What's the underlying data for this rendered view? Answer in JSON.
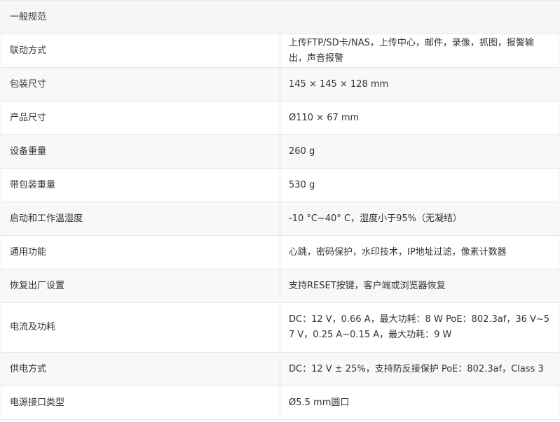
{
  "section": {
    "title": "一般规范"
  },
  "rows": [
    {
      "label": "联动方式",
      "value": "上传FTP/SD卡/NAS，上传中心，邮件，录像，抓图，报警输出，声音报警"
    },
    {
      "label": "包装尺寸",
      "value": "145 × 145 × 128 mm"
    },
    {
      "label": "产品尺寸",
      "value": "Ø110 × 67 mm"
    },
    {
      "label": "设备重量",
      "value": "260 g"
    },
    {
      "label": "带包装重量",
      "value": "530 g"
    },
    {
      "label": "启动和工作温湿度",
      "value": "-10 °C~40° C，湿度小于95%（无凝结）"
    },
    {
      "label": "通用功能",
      "value": "心跳，密码保护，水印技术，IP地址过滤，像素计数器"
    },
    {
      "label": "恢复出厂设置",
      "value": "支持RESET按键，客户端或浏览器恢复"
    },
    {
      "label": "电流及功耗",
      "value": "DC：12 V，0.66 A，最大功耗：8 W PoE：802.3af，36 V~57 V，0.25 A~0.15 A，最大功耗：9 W"
    },
    {
      "label": "供电方式",
      "value": "DC：12 V ± 25%，支持防反接保护 PoE：802.3af，Class 3"
    },
    {
      "label": "电源接口类型",
      "value": "Ø5.5 mm圆口"
    }
  ]
}
